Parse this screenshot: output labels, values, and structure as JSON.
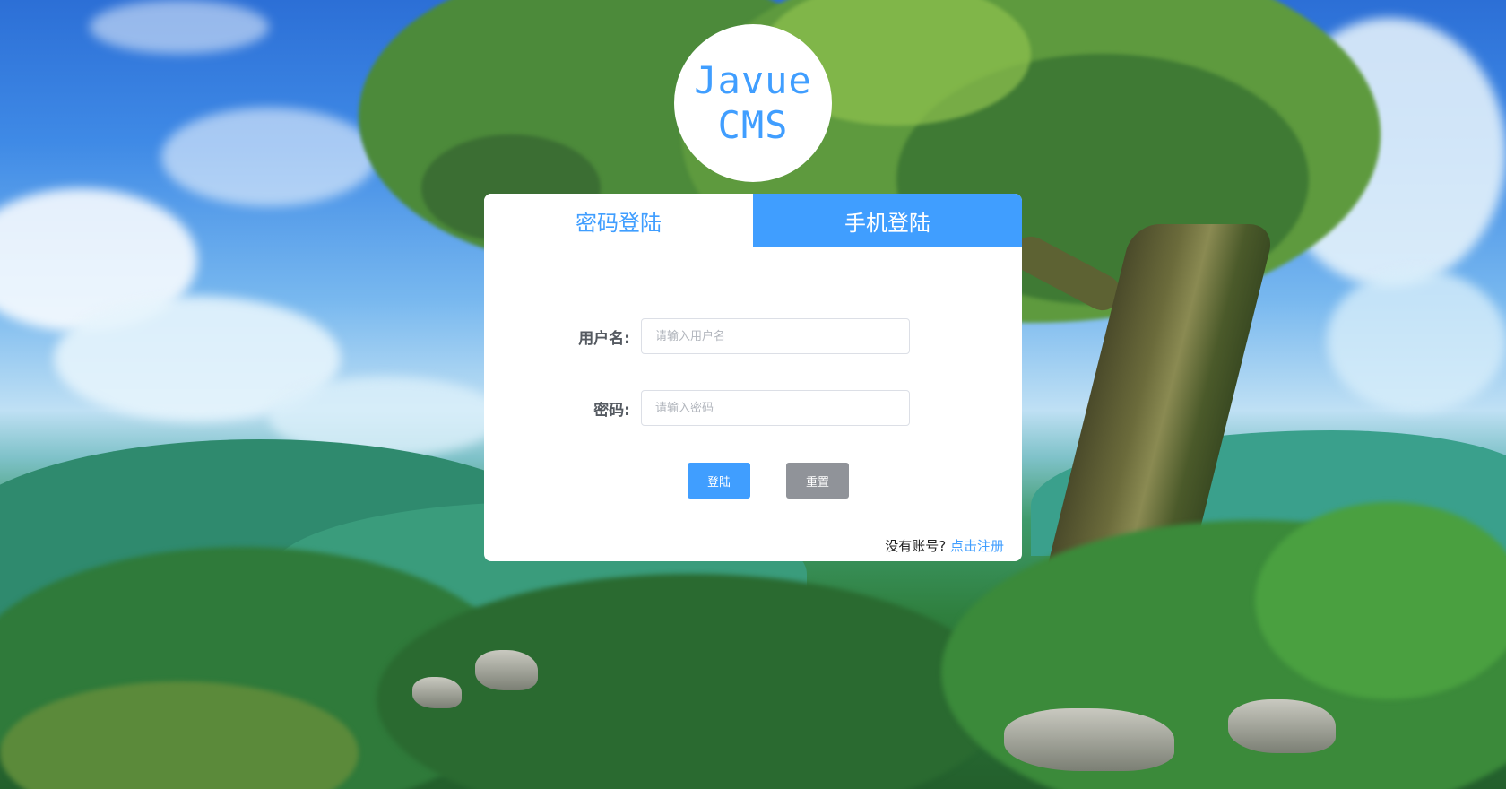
{
  "logo": {
    "line1": "Javue",
    "line2": "CMS"
  },
  "tabs": [
    {
      "label": "密码登陆",
      "active": true
    },
    {
      "label": "手机登陆",
      "active": false
    }
  ],
  "form": {
    "username_label": "用户名:",
    "username_placeholder": "请输入用户名",
    "username_value": "",
    "password_label": "密码:",
    "password_placeholder": "请输入密码",
    "password_value": ""
  },
  "buttons": {
    "login_label": "登陆",
    "reset_label": "重置"
  },
  "register": {
    "prompt": "没有账号?",
    "link_label": "点击注册"
  },
  "colors": {
    "accent": "#409eff",
    "reset_button": "#909399",
    "label_text": "#555a61"
  }
}
